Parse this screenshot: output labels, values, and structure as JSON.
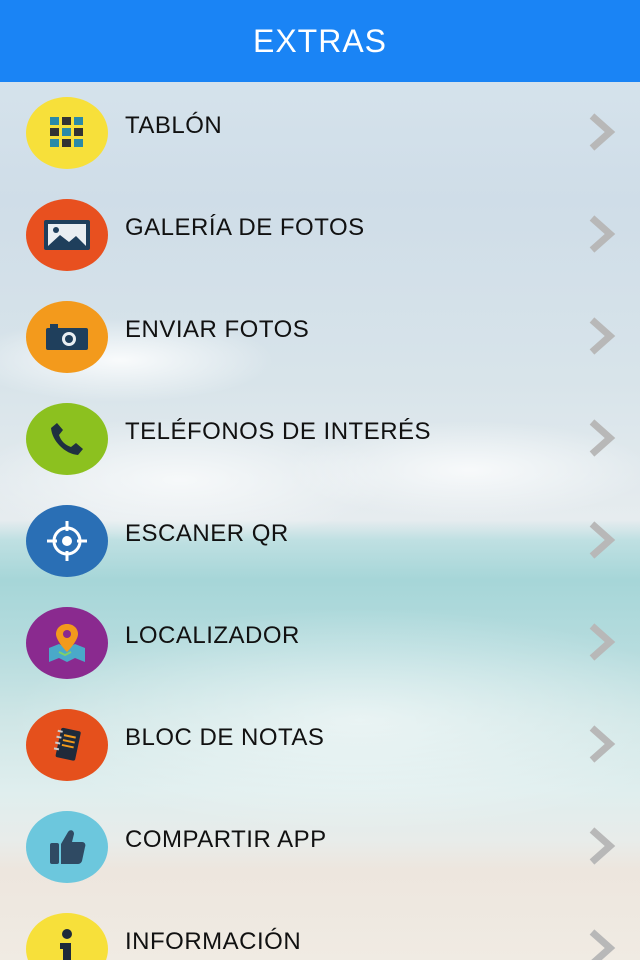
{
  "header": {
    "title": "EXTRAS"
  },
  "menu": {
    "items": [
      {
        "label": "TABLÓN",
        "icon": "grid-icon",
        "color": "#f7e03a"
      },
      {
        "label": "GALERÍA DE FOTOS",
        "icon": "image-icon",
        "color": "#e8501f"
      },
      {
        "label": "ENVIAR FOTOS",
        "icon": "camera-icon",
        "color": "#f39a1c"
      },
      {
        "label": "TELÉFONOS DE INTERÉS",
        "icon": "phone-icon",
        "color": "#8cc11f"
      },
      {
        "label": "ESCANER QR",
        "icon": "crosshair-icon",
        "color": "#2a6fb5"
      },
      {
        "label": "LOCALIZADOR",
        "icon": "map-pin-icon",
        "color": "#8a2a8f"
      },
      {
        "label": "BLOC DE NOTAS",
        "icon": "notebook-icon",
        "color": "#e5501c"
      },
      {
        "label": "COMPARTIR APP",
        "icon": "thumbs-up-icon",
        "color": "#6cc7dd"
      },
      {
        "label": "INFORMACIÓN",
        "icon": "info-icon",
        "color": "#f7e03a"
      }
    ]
  }
}
